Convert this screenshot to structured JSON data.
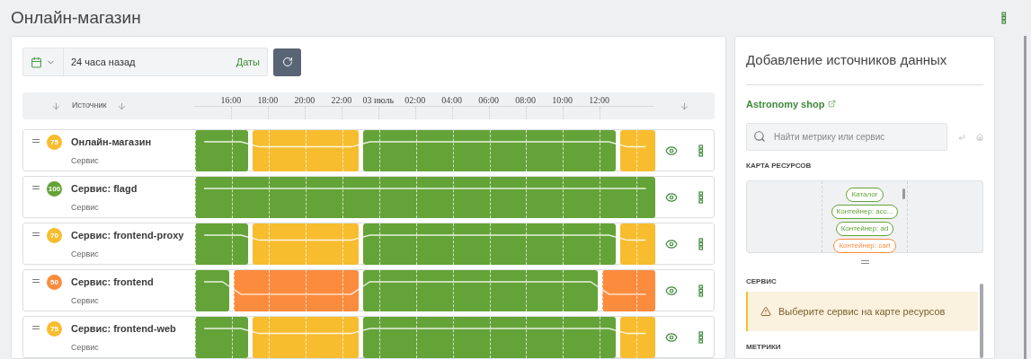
{
  "page_title": "Онлайн-магазин",
  "toolbar": {
    "period": "24 часа назад",
    "dates_link": "Даты"
  },
  "table": {
    "columns": [
      "Источник"
    ],
    "ticks": [
      "16:00",
      "18:00",
      "20:00",
      "22:00",
      "03 июль",
      "02:00",
      "04:00",
      "06:00",
      "08:00",
      "10:00",
      "12:00"
    ],
    "rows": [
      {
        "score": "75",
        "color": "#f7bd2f",
        "name": "Онлайн-магазин",
        "type": "Сервис",
        "timeline": [
          {
            "color": "#64a338"
          },
          {
            "color": "#64a338"
          },
          {
            "color": "#64a338"
          },
          {
            "color": "#f7bd2f"
          },
          {
            "color": "#f7bd2f"
          },
          {
            "color": "#f7bd2f"
          },
          {
            "color": "#f7bd2f"
          },
          {
            "color": "#f7bd2f"
          },
          {
            "color": "#f7bd2f"
          },
          {
            "color": "#64a338"
          },
          {
            "color": "#64a338"
          },
          {
            "color": "#64a338"
          },
          {
            "color": "#64a338"
          },
          {
            "color": "#64a338"
          },
          {
            "color": "#64a338"
          },
          {
            "color": "#64a338"
          },
          {
            "color": "#64a338"
          },
          {
            "color": "#64a338"
          },
          {
            "color": "#64a338"
          },
          {
            "color": "#64a338"
          },
          {
            "color": "#64a338"
          },
          {
            "color": "#64a338"
          },
          {
            "color": "#64a338"
          },
          {
            "color": "#f7bd2f"
          },
          {
            "color": "#f7bd2f"
          }
        ]
      },
      {
        "score": "100",
        "color": "#64a338",
        "name": "Сервис: flagd",
        "type": "Сервис",
        "timeline": [
          {
            "color": "#64a338"
          },
          {
            "color": "#64a338"
          },
          {
            "color": "#64a338"
          },
          {
            "color": "#64a338"
          },
          {
            "color": "#64a338"
          },
          {
            "color": "#64a338"
          },
          {
            "color": "#64a338"
          },
          {
            "color": "#64a338"
          },
          {
            "color": "#64a338"
          },
          {
            "color": "#64a338"
          },
          {
            "color": "#64a338"
          },
          {
            "color": "#64a338"
          },
          {
            "color": "#64a338"
          },
          {
            "color": "#64a338"
          },
          {
            "color": "#64a338"
          },
          {
            "color": "#64a338"
          },
          {
            "color": "#64a338"
          },
          {
            "color": "#64a338"
          },
          {
            "color": "#64a338"
          },
          {
            "color": "#64a338"
          },
          {
            "color": "#64a338"
          },
          {
            "color": "#64a338"
          },
          {
            "color": "#64a338"
          },
          {
            "color": "#64a338"
          },
          {
            "color": "#64a338"
          }
        ]
      },
      {
        "score": "70",
        "color": "#f7bd2f",
        "name": "Сервис: frontend-proxy",
        "type": "Сервис",
        "timeline": [
          {
            "color": "#64a338"
          },
          {
            "color": "#64a338"
          },
          {
            "color": "#64a338"
          },
          {
            "color": "#f7bd2f"
          },
          {
            "color": "#f7bd2f"
          },
          {
            "color": "#f7bd2f"
          },
          {
            "color": "#f7bd2f"
          },
          {
            "color": "#f7bd2f"
          },
          {
            "color": "#f7bd2f"
          },
          {
            "color": "#64a338"
          },
          {
            "color": "#64a338"
          },
          {
            "color": "#64a338"
          },
          {
            "color": "#64a338"
          },
          {
            "color": "#64a338"
          },
          {
            "color": "#64a338"
          },
          {
            "color": "#64a338"
          },
          {
            "color": "#64a338"
          },
          {
            "color": "#64a338"
          },
          {
            "color": "#64a338"
          },
          {
            "color": "#64a338"
          },
          {
            "color": "#64a338"
          },
          {
            "color": "#64a338"
          },
          {
            "color": "#64a338"
          },
          {
            "color": "#f7bd2f"
          },
          {
            "color": "#f7bd2f"
          }
        ]
      },
      {
        "score": "50",
        "color": "#fb8c3e",
        "name": "Сервис: frontend",
        "type": "Сервис",
        "timeline": [
          {
            "color": "#64a338"
          },
          {
            "color": "#64a338"
          },
          {
            "color": "#fb8c3e"
          },
          {
            "color": "#fb8c3e"
          },
          {
            "color": "#fb8c3e"
          },
          {
            "color": "#fb8c3e"
          },
          {
            "color": "#fb8c3e"
          },
          {
            "color": "#fb8c3e"
          },
          {
            "color": "#fb8c3e"
          },
          {
            "color": "#64a338"
          },
          {
            "color": "#64a338"
          },
          {
            "color": "#64a338"
          },
          {
            "color": "#64a338"
          },
          {
            "color": "#64a338"
          },
          {
            "color": "#64a338"
          },
          {
            "color": "#64a338"
          },
          {
            "color": "#64a338"
          },
          {
            "color": "#64a338"
          },
          {
            "color": "#64a338"
          },
          {
            "color": "#64a338"
          },
          {
            "color": "#64a338"
          },
          {
            "color": "#64a338"
          },
          {
            "color": "#fb8c3e"
          },
          {
            "color": "#fb8c3e"
          },
          {
            "color": "#fb8c3e"
          }
        ]
      },
      {
        "score": "75",
        "color": "#f7bd2f",
        "name": "Сервис: frontend-web",
        "type": "Сервис",
        "timeline": [
          {
            "color": "#64a338"
          },
          {
            "color": "#64a338"
          },
          {
            "color": "#64a338"
          },
          {
            "color": "#f7bd2f"
          },
          {
            "color": "#f7bd2f"
          },
          {
            "color": "#f7bd2f"
          },
          {
            "color": "#f7bd2f"
          },
          {
            "color": "#f7bd2f"
          },
          {
            "color": "#f7bd2f"
          },
          {
            "color": "#64a338"
          },
          {
            "color": "#64a338"
          },
          {
            "color": "#64a338"
          },
          {
            "color": "#64a338"
          },
          {
            "color": "#64a338"
          },
          {
            "color": "#64a338"
          },
          {
            "color": "#64a338"
          },
          {
            "color": "#64a338"
          },
          {
            "color": "#64a338"
          },
          {
            "color": "#64a338"
          },
          {
            "color": "#64a338"
          },
          {
            "color": "#64a338"
          },
          {
            "color": "#64a338"
          },
          {
            "color": "#64a338"
          },
          {
            "color": "#f7bd2f"
          },
          {
            "color": "#f7bd2f"
          }
        ]
      }
    ]
  },
  "side_panel": {
    "title": "Добавление источников данных",
    "link": "Astronomy shop",
    "search": {
      "placeholder": "Найти метрику или сервис"
    },
    "map_label": "КАРТА РЕСУРСОВ",
    "map_nodes": [
      {
        "label": "Каталог",
        "color": "#64a338"
      },
      {
        "label": "Контейнер: acc...",
        "color": "#64a338"
      },
      {
        "label": "Контейнер: ad",
        "color": "#64a338"
      },
      {
        "label": "Контейнер: cart",
        "color": "#fb8c3e"
      }
    ],
    "service_label": "СЕРВИС",
    "warning": "Выберите сервис на карте ресурсов",
    "metrics_label": "МЕТРИКИ"
  }
}
